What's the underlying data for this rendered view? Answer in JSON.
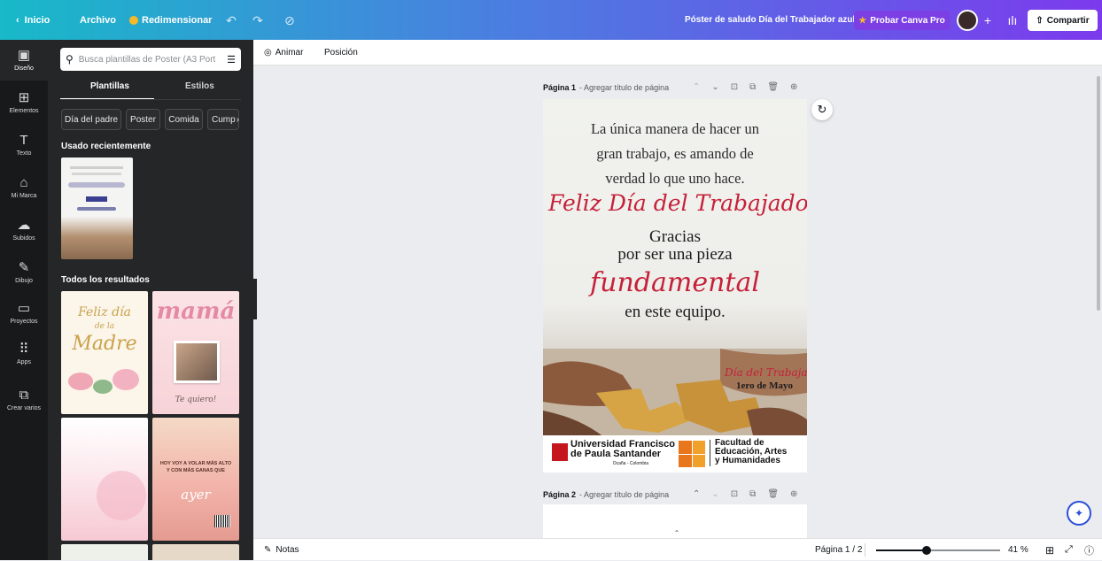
{
  "topbar": {
    "back_label": "Inicio",
    "file_label": "Archivo",
    "resize_label": "Redimensionar",
    "doc_title": "Póster de saludo Día del Trabajador azul",
    "pro_label": "Probar Canva Pro",
    "share_label": "Compartir"
  },
  "rail": [
    {
      "label": "Diseño",
      "icon": "▣"
    },
    {
      "label": "Elementos",
      "icon": "⊞"
    },
    {
      "label": "Texto",
      "icon": "T"
    },
    {
      "label": "Mi Marca",
      "icon": "⌂"
    },
    {
      "label": "Subidos",
      "icon": "☁"
    },
    {
      "label": "Dibujo",
      "icon": "✎"
    },
    {
      "label": "Proyectos",
      "icon": "▭"
    },
    {
      "label": "Apps",
      "icon": "⠿"
    },
    {
      "label": "Crear varios",
      "icon": "⧉"
    }
  ],
  "panel": {
    "search_placeholder": "Busca plantillas de Poster (A3 Port",
    "tab_templates": "Plantillas",
    "tab_styles": "Estilos",
    "chips": [
      "Día del padre",
      "Poster",
      "Comida",
      "Cump"
    ],
    "recent_title": "Usado recientemente",
    "results_title": "Todos los resultados",
    "thumb1_line1": "Feliz día",
    "thumb1_line2": "de la",
    "thumb1_line3": "Madre",
    "thumb2_title": "mamá",
    "thumb2_caption": "Te quiero!",
    "thumb4_text": "HOY VOY A VOLAR MÁS ALTO Y CON MÁS GANAS QUE",
    "thumb4_script": "ayer"
  },
  "ctxbar": {
    "animate_label": "Animar",
    "position_label": "Posición"
  },
  "page1": {
    "label": "Página 1",
    "add_title": "- Agregar título de página"
  },
  "page2": {
    "label": "Página 2",
    "add_title": "- Agregar título de página"
  },
  "poster": {
    "quote_l1": "La única manera de hacer un",
    "quote_l2": "gran trabajo, es amando de",
    "quote_l3": "verdad lo que uno hace.",
    "script_title": "Feliz Día del Trabajador",
    "thanks": "Gracias",
    "piece": "por ser una pieza",
    "fundamental": "fundamental",
    "team": "en este equipo.",
    "small_script": "Día del Trabajador",
    "date": "1ero de Mayo",
    "uni_l1": "Universidad Francisco",
    "uni_l2": "de Paula Santander",
    "uni_l3": "Ocaña - Colombia",
    "fac_l1": "Facultad de",
    "fac_l2": "Educación, Artes",
    "fac_l3": "y Humanidades"
  },
  "bottombar": {
    "notes_label": "Notas",
    "page_counter": "Página 1 / 2",
    "zoom": "41 %",
    "zoom_fraction": 0.41
  }
}
